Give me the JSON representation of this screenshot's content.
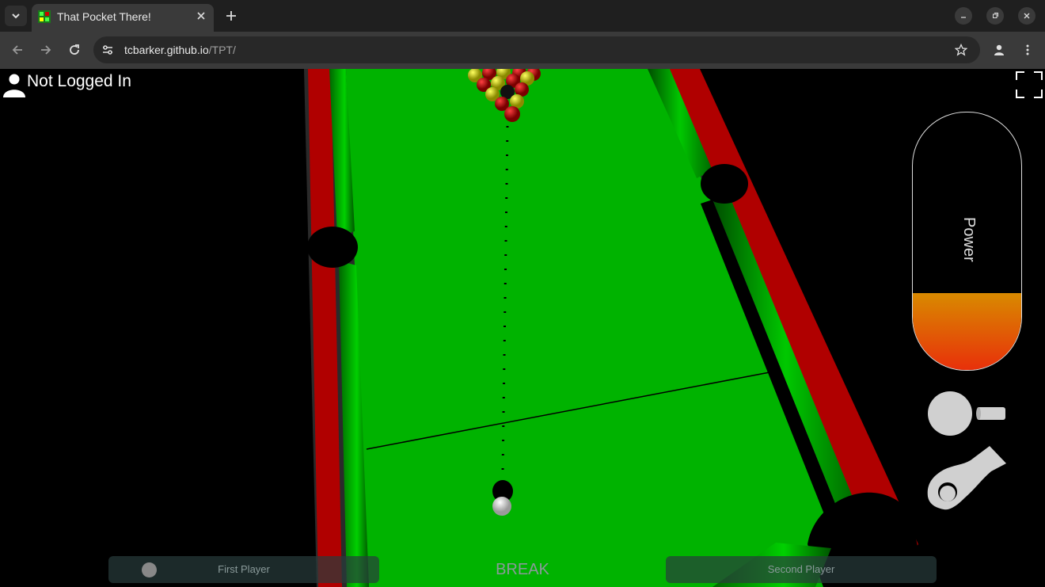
{
  "browser": {
    "tab_title": "That Pocket There!",
    "url_host": "tcbarker.github.io",
    "url_path": "/TPT/"
  },
  "icons": {
    "tab_list": "chevron-down-icon",
    "close": "close-icon",
    "new_tab": "plus-icon",
    "back": "back-arrow-icon",
    "forward": "forward-arrow-icon",
    "reload": "reload-icon",
    "site_info": "tune-icon",
    "bookmark": "star-icon",
    "profile": "person-icon",
    "menu": "kebab-menu-icon",
    "fullscreen": "fullscreen-icon",
    "spin": "cue-spin-icon",
    "ball_in_hand": "hand-ball-icon"
  },
  "game": {
    "login_status": "Not Logged In",
    "power_label": "Power",
    "power_level": 0.3,
    "player1": "First Player",
    "player2": "Second Player",
    "status": "BREAK"
  },
  "colors": {
    "cloth": "#00b300",
    "rail": "#b00000",
    "power_top": "#d98a00",
    "power_bottom": "#e8300a"
  }
}
